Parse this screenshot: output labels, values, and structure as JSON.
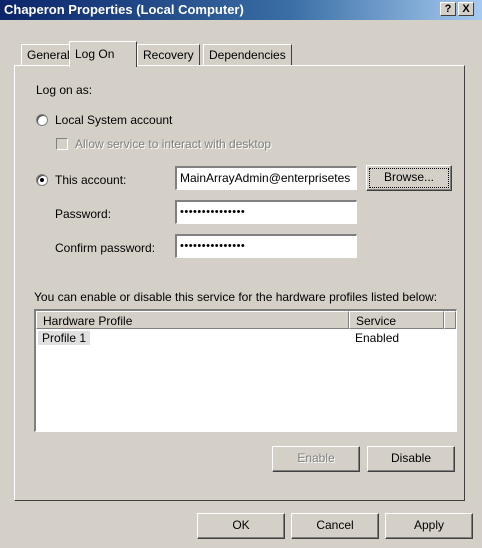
{
  "window": {
    "title": "Chaperon Properties (Local Computer)",
    "help_button": "?",
    "close_button": "X"
  },
  "tabs": [
    {
      "label": "General",
      "selected": false
    },
    {
      "label": "Log On",
      "selected": true
    },
    {
      "label": "Recovery",
      "selected": false
    },
    {
      "label": "Dependencies",
      "selected": false
    }
  ],
  "logon": {
    "log_on_as_label": "Log on as:",
    "local_system": {
      "label": "Local System account",
      "selected": false
    },
    "interact_desktop": {
      "label": "Allow service to interact with desktop",
      "checked": false,
      "enabled": false
    },
    "this_account": {
      "label": "This account:",
      "selected": true,
      "value": "MainArrayAdmin@enterprisetes"
    },
    "browse_label": "Browse...",
    "password": {
      "label": "Password:",
      "value": "•••••••••••••••"
    },
    "confirm_password": {
      "label": "Confirm password:",
      "value": "•••••••••••••••"
    }
  },
  "profiles": {
    "description": "You can enable or disable this service for the hardware profiles listed below:",
    "columns": [
      "Hardware Profile",
      "Service"
    ],
    "rows": [
      {
        "profile": "Profile 1",
        "service": "Enabled",
        "selected": true
      }
    ],
    "enable_label": "Enable",
    "disable_label": "Disable"
  },
  "footer": {
    "ok_label": "OK",
    "cancel_label": "Cancel",
    "apply_label": "Apply"
  },
  "colors": {
    "titlebar_start": "#0a246a",
    "titlebar_end": "#a6caf0",
    "face": "#d4d0c8",
    "selection": "#e0e0e0"
  }
}
